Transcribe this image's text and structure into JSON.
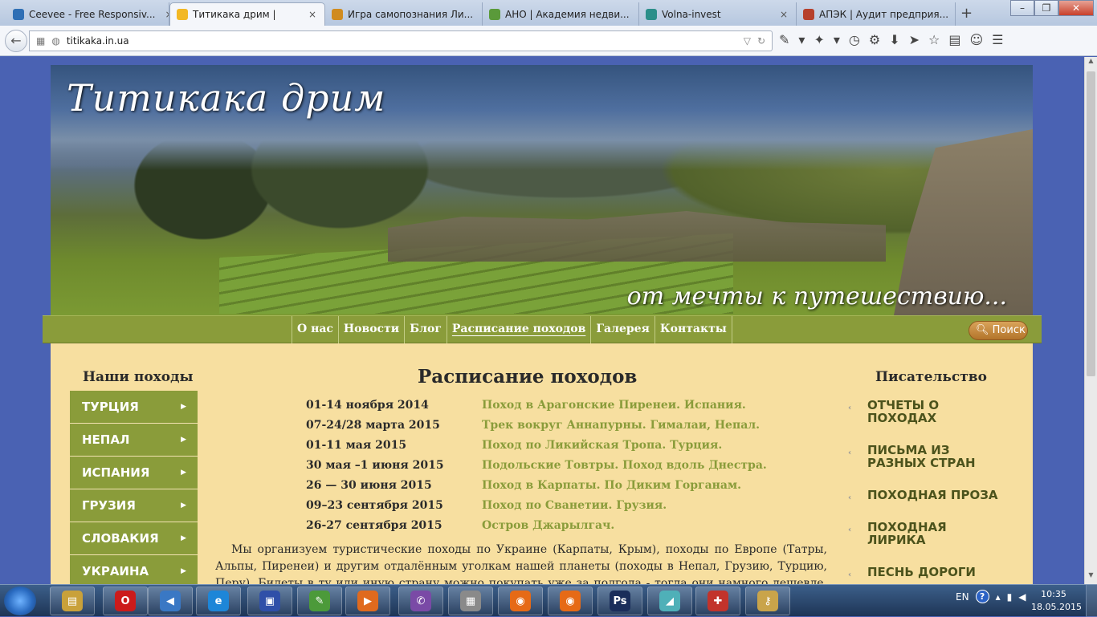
{
  "browser": {
    "tabs": [
      {
        "label": "Ceevee - Free Responsiv...",
        "fav_color": "#2f6fb5",
        "active": false
      },
      {
        "label": "Титикака дрим |",
        "fav_color": "#f2b824",
        "active": true
      },
      {
        "label": "Игра самопознания Ли...",
        "fav_color": "#d08b1f",
        "active": false
      },
      {
        "label": "АНО | Академия недви...",
        "fav_color": "#5a9a3a",
        "active": false
      },
      {
        "label": "Volna-invest",
        "fav_color": "#2b8f8a",
        "active": false
      },
      {
        "label": "АПЭК | Аудит предприя...",
        "fav_color": "#b6402c",
        "active": false
      }
    ],
    "url": "titikaka.in.ua"
  },
  "site": {
    "title": "Титикака дрим",
    "tagline": "от мечты к путешествию...",
    "menu": [
      "О нас",
      "Новости",
      "Блог",
      "Расписание походов",
      "Галерея",
      "Контакты"
    ],
    "search_label": "Поиск"
  },
  "left": {
    "heading": "Наши походы",
    "items": [
      "ТУРЦИЯ",
      "НЕПАЛ",
      "ИСПАНИЯ",
      "ГРУЗИЯ",
      "СЛОВАКИЯ",
      "УКРАИНА"
    ]
  },
  "main": {
    "heading": "Расписание походов",
    "schedule": [
      {
        "date": "01-14 ноября 2014",
        "title": "Поход в Арагонские Пиренеи. Испания."
      },
      {
        "date": "07-24/28 марта 2015",
        "title": "Трек вокруг Аннапурны. Гималаи, Непал."
      },
      {
        "date": "01-11 мая 2015",
        "title": "Поход по Ликийская Тропа. Турция."
      },
      {
        "date": "30 мая –1 июня 2015",
        "title": "Подольские Товтры. Поход вдоль Днестра."
      },
      {
        "date": "26 — 30 июня 2015",
        "title": "Поход в Карпаты. По Диким Горганам."
      },
      {
        "date": "09–23 сентября 2015",
        "title": "Поход по Сванетии. Грузия."
      },
      {
        "date": "26-27 сентября 2015",
        "title": "Остров Джарылгач."
      }
    ],
    "paragraph": "Мы организуем туристические походы по Украине (Карпаты, Крым), походы по Европе (Татры, Альпы, Пиренеи) и другим отдалённым уголкам нашей планеты (походы в Непал, Грузию, Турцию, Перу). Билеты в ту или иную страну можно покупать уже за полгода - тогда они намного дешевле. Так что, если Вы приняли решение"
  },
  "right": {
    "heading": "Писательство",
    "items": [
      "ОТЧЕТЫ О ПОХОДАХ",
      "ПИСЬМА ИЗ РАЗНЫХ СТРАН",
      "ПОХОДНАЯ ПРОЗА",
      "ПОХОДНАЯ ЛИРИКА",
      "ПЕСНЬ ДОРОГИ"
    ]
  },
  "taskbar": {
    "apps": [
      {
        "name": "explorer",
        "color": "#c9a13a"
      },
      {
        "name": "opera",
        "color": "#cc1b1b"
      },
      {
        "name": "media",
        "color": "#3a78c4"
      },
      {
        "name": "ie",
        "color": "#1d86d8"
      },
      {
        "name": "save",
        "color": "#2f4fa8"
      },
      {
        "name": "notepad",
        "color": "#4c9a3a"
      },
      {
        "name": "player",
        "color": "#e06a1e"
      },
      {
        "name": "viber",
        "color": "#7a4aa6"
      },
      {
        "name": "document",
        "color": "#8a8a8a"
      },
      {
        "name": "firefox",
        "color": "#e66a16"
      },
      {
        "name": "firefox",
        "color": "#e66a16"
      },
      {
        "name": "photoshop",
        "color": "#1a2d5a"
      },
      {
        "name": "notes",
        "color": "#4fb0b8"
      },
      {
        "name": "presentation",
        "color": "#c2332b"
      },
      {
        "name": "keys",
        "color": "#c9a44a"
      }
    ],
    "lang": "EN",
    "time": "10:35",
    "date": "18.05.2015"
  }
}
